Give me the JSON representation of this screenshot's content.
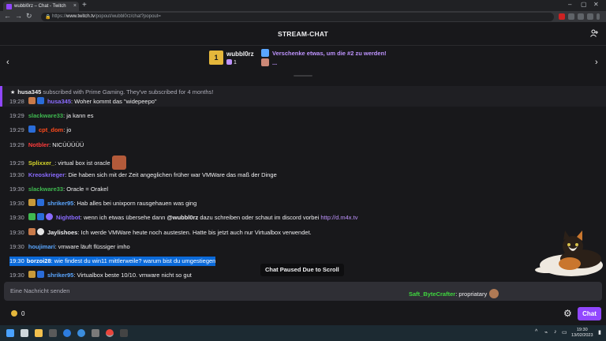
{
  "browser": {
    "tab_title": "wubbl0rz – Chat - Twitch",
    "tab_close": "×",
    "new_tab": "+",
    "url_prefix": "https://",
    "url_host": "www.twitch.tv",
    "url_path": "/popout/wubbl0rz/chat?popout=",
    "back": "←",
    "forward": "→",
    "reload": "↻"
  },
  "header": {
    "title": "STREAM-CHAT"
  },
  "banner": {
    "gift_count_label": "1",
    "user": "wubbl0rz",
    "sub_count": "1",
    "cta_line1": "Verschenke etwas, um die #2 zu werden!",
    "cta_line2": "...",
    "prev": "‹",
    "next": "›"
  },
  "subscription": {
    "user": "husa345",
    "text": "subscribed with Prime Gaming. They've subscribed for 4 months!"
  },
  "messages": [
    {
      "time": "19:28",
      "user": "husa345",
      "color": "#8a6bff",
      "text": ": Woher kommt das \"widepeepo\""
    },
    {
      "time": "19:29",
      "user": "slackware33",
      "color": "#3fb950",
      "text": ": ja kann es"
    },
    {
      "time": "19:29",
      "user": "cpt_dom",
      "color": "#ff4a1c",
      "text": ": jo"
    },
    {
      "time": "19:29",
      "user": "Notbler",
      "color": "#ff3b3b",
      "text": ": NICÜÜÜÜÜ"
    },
    {
      "time": "19:29",
      "user": "Splixxer_",
      "color": "#d6d62a",
      "text": ": virtual box ist oracle"
    },
    {
      "time": "19:30",
      "user": "Kreoskrieger",
      "color": "#8a6bff",
      "text": ": Die haben sich mit der Zeit angeglichen früher war VMWare das maß der Dinge"
    },
    {
      "time": "19:30",
      "user": "slackware33",
      "color": "#3fb950",
      "text": ": Oracle = Orakel"
    },
    {
      "time": "19:30",
      "user": "shriker95",
      "color": "#5aa6ff",
      "text": ": Hab alles bei unixporn rausgehauen was ging"
    },
    {
      "time": "19:30",
      "user": "Nightbot",
      "color": "#8a6bff",
      "text": ": wenn ich etwas übersehe dann ",
      "mention": "@wubbl0rz",
      "text2": " dazu schreiben oder schaut im discord vorbei ",
      "link": "http://d.m4x.tv"
    },
    {
      "time": "19:30",
      "user": "Jaylishoes",
      "color": "#efeff1",
      "text": ": Ich werde VMWare heute noch austesten. Hatte bis jetzt auch nur Virtualbox verwendet."
    },
    {
      "time": "19:30",
      "user": "houjimari",
      "color": "#5aa6ff",
      "text": ": vmware läuft flüssiger imho"
    },
    {
      "time": "19:30",
      "user": "borzoi28",
      "color": "#ffffff",
      "text": ": wie findest du win11 mittlerweile? warum bist du umgestiegen"
    },
    {
      "time": "19:30",
      "user": "shriker95",
      "color": "#5aa6ff",
      "text": ": Virtualbox beste 10/10. vmware nicht so gut"
    }
  ],
  "paused_label": "Chat Paused Due to Scroll",
  "input": {
    "placeholder": "Eine Nachricht senden"
  },
  "overlay": {
    "user": "Saft_ByteCrafter",
    "text": ": propriatary"
  },
  "bottom": {
    "points": "0",
    "chat_button": "Chat"
  },
  "taskbar": {
    "time": "19:30",
    "date": "13/02/2023"
  },
  "icons": {
    "users": "users-icon",
    "settings": "gear-icon",
    "gift": "gift-icon"
  }
}
